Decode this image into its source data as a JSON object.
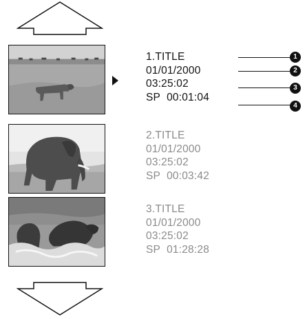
{
  "titles": [
    {
      "name": "1.TITLE",
      "date": "01/01/2000",
      "time": "03:25:02",
      "speed": "SP",
      "duration": "00:01:04",
      "state": "selected"
    },
    {
      "name": "2.TITLE",
      "date": "01/01/2000",
      "time": "03:25:02",
      "speed": "SP",
      "duration": "00:03:42",
      "state": "inactive"
    },
    {
      "name": "3.TITLE",
      "date": "01/01/2000",
      "time": "03:25:02",
      "speed": "SP",
      "duration": "01:28:28",
      "state": "inactive"
    }
  ],
  "callouts": [
    "1",
    "2",
    "3",
    "4"
  ],
  "icons": {
    "scroll_up": "up-arrow-icon",
    "scroll_down": "down-arrow-icon",
    "cursor": "play-cursor-icon"
  },
  "colors": {
    "selected_text": "#111111",
    "inactive_text": "#8a8a8a",
    "callout_badge": "#111111"
  }
}
